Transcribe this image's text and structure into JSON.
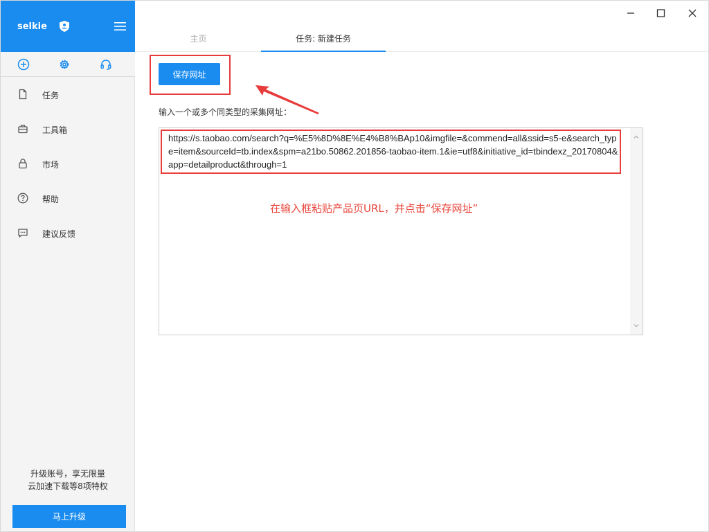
{
  "app": {
    "brand_name": "selkie"
  },
  "sidebar": {
    "nav": [
      {
        "label": "任务",
        "icon": "document-icon"
      },
      {
        "label": "工具箱",
        "icon": "toolbox-icon"
      },
      {
        "label": "市场",
        "icon": "lock-icon"
      },
      {
        "label": "帮助",
        "icon": "help-icon"
      },
      {
        "label": "建议反馈",
        "icon": "feedback-icon"
      }
    ],
    "promo_line1": "升级账号，享无限量",
    "promo_line2": "云加速下载等8项特权",
    "upgrade_label": "马上升级"
  },
  "tabs": {
    "home": "主页",
    "task": "任务: 新建任务"
  },
  "main": {
    "save_label": "保存网址",
    "input_label": "输入一个或多个同类型的采集网址：",
    "url_value": "https://s.taobao.com/search?q=%E5%8D%8E%E4%B8%BAp10&imgfile=&commend=all&ssid=s5-e&search_type=item&sourceId=tb.index&spm=a21bo.50862.201856-taobao-item.1&ie=utf8&initiative_id=tbindexz_20170804&app=detailproduct&through=1",
    "hint": "在输入框粘贴产品页URL，并点击“保存网址”"
  },
  "colors": {
    "accent": "#1a8cf0",
    "annotation": "#e83b3b"
  }
}
